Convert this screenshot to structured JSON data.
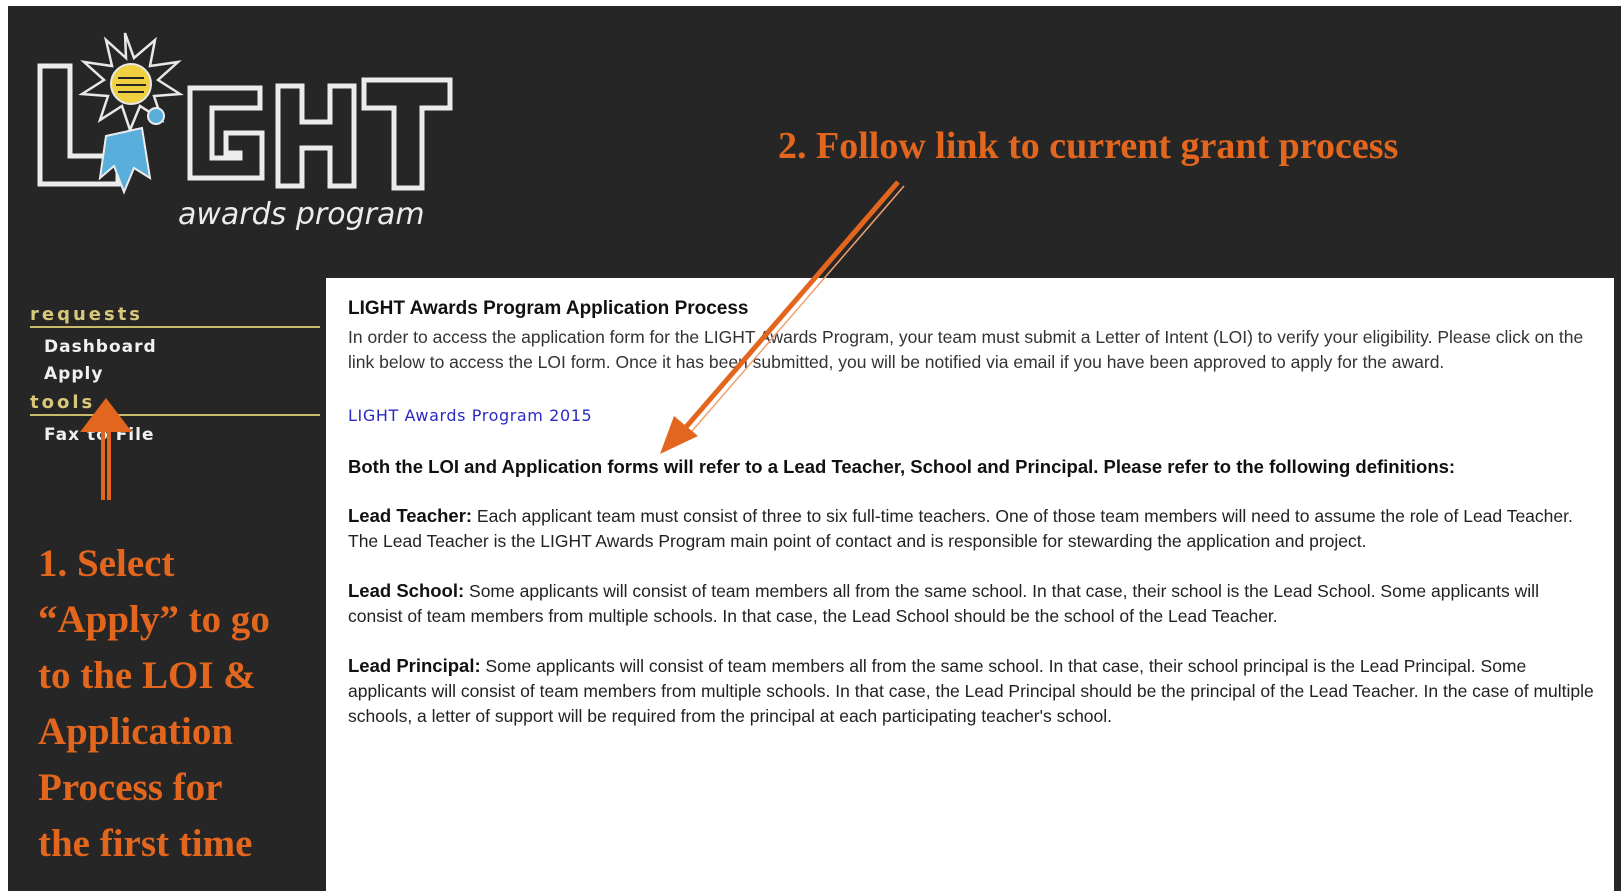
{
  "logo": {
    "main_text": "LIGHT",
    "sub_text": "awards program"
  },
  "sidebar": {
    "sections": [
      {
        "heading": "requests",
        "items": [
          {
            "label": "Dashboard"
          },
          {
            "label": "Apply"
          }
        ]
      },
      {
        "heading": "tools",
        "items": [
          {
            "label": "Fax to File"
          }
        ]
      }
    ]
  },
  "annotations": {
    "step1_lines": [
      "1. Select",
      "“Apply” to go",
      "to the LOI &",
      "Application",
      "Process for",
      "the first time"
    ],
    "step2": "2. Follow link to current  grant process"
  },
  "content": {
    "title": "LIGHT Awards Program Application Process",
    "intro": "In order to access the application form for the LIGHT Awards Program, your team must submit a Letter of Intent (LOI) to verify your eligibility. Please click on the link below to access the LOI form. Once it has been submitted, you will be notified via email if you have been approved to apply for the award.",
    "link_label": "LIGHT Awards Program 2015",
    "definitions_intro": "Both the LOI and Application forms will refer to a Lead Teacher, School and Principal. Please refer to the following definitions:",
    "definitions": [
      {
        "term": "Lead Teacher:",
        "text": " Each applicant team must consist of three to six full-time teachers. One of those team members will need to assume the role of Lead Teacher. The Lead Teacher is the LIGHT Awards Program main point of contact and is responsible for stewarding the application and project."
      },
      {
        "term": "Lead School:",
        "text": " Some applicants will consist of team members all from the same school. In that case, their school is the Lead School. Some applicants will consist of team members from multiple schools. In that case, the Lead School should be the school of the Lead Teacher."
      },
      {
        "term": "Lead Principal:",
        "text": " Some applicants will consist of team members all from the same school. In that case, their school principal is the Lead Principal. Some applicants will consist of team members from multiple schools. In that case, the Lead Principal should be the principal of the Lead Teacher. In the case of multiple schools, a letter of support will be required from the principal at each participating teacher's school."
      }
    ]
  },
  "colors": {
    "background": "#262626",
    "annotation": "#e3661e",
    "sidebar_heading": "#d8c87a",
    "link": "#2a2ac0"
  }
}
